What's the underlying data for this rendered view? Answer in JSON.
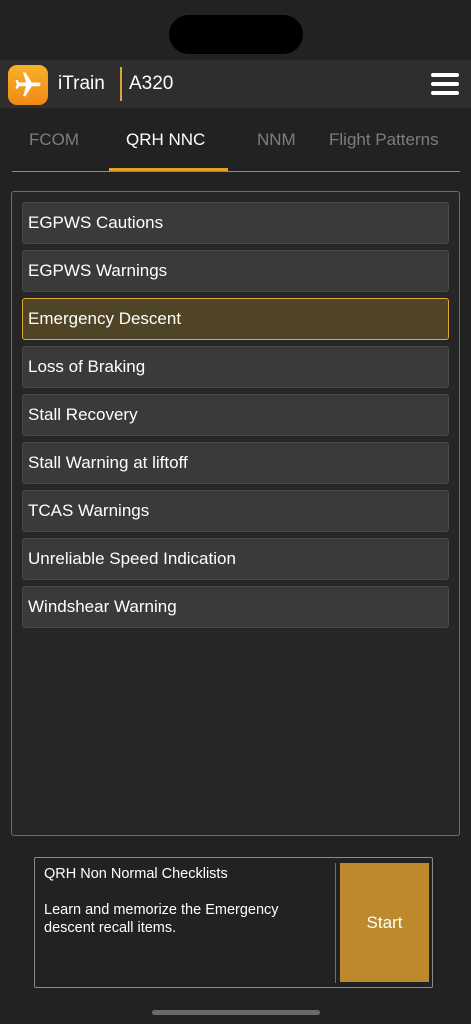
{
  "header": {
    "app_name": "iTrain",
    "aircraft": "A320",
    "logo_icon": "airplane-icon",
    "menu_icon": "hamburger-menu-icon"
  },
  "tabs": [
    {
      "label": "FCOM",
      "active": false
    },
    {
      "label": "QRH NNC",
      "active": true
    },
    {
      "label": "NNM",
      "active": false
    },
    {
      "label": "Flight Patterns",
      "active": false
    }
  ],
  "checklist": {
    "items": [
      {
        "label": "EGPWS Cautions",
        "selected": false
      },
      {
        "label": "EGPWS Warnings",
        "selected": false
      },
      {
        "label": "Emergency Descent",
        "selected": true
      },
      {
        "label": "Loss of Braking",
        "selected": false
      },
      {
        "label": "Stall Recovery",
        "selected": false
      },
      {
        "label": "Stall Warning at liftoff",
        "selected": false
      },
      {
        "label": "TCAS Warnings",
        "selected": false
      },
      {
        "label": "Unreliable Speed Indication",
        "selected": false
      },
      {
        "label": "Windshear Warning",
        "selected": false
      }
    ]
  },
  "info_card": {
    "title": "QRH Non Normal Checklists",
    "description": "Learn and memorize the Emergency descent recall items.",
    "start_label": "Start"
  },
  "colors": {
    "accent": "#e6a024",
    "selected_bg": "#4f4426",
    "start_button": "#bc8a2c"
  }
}
